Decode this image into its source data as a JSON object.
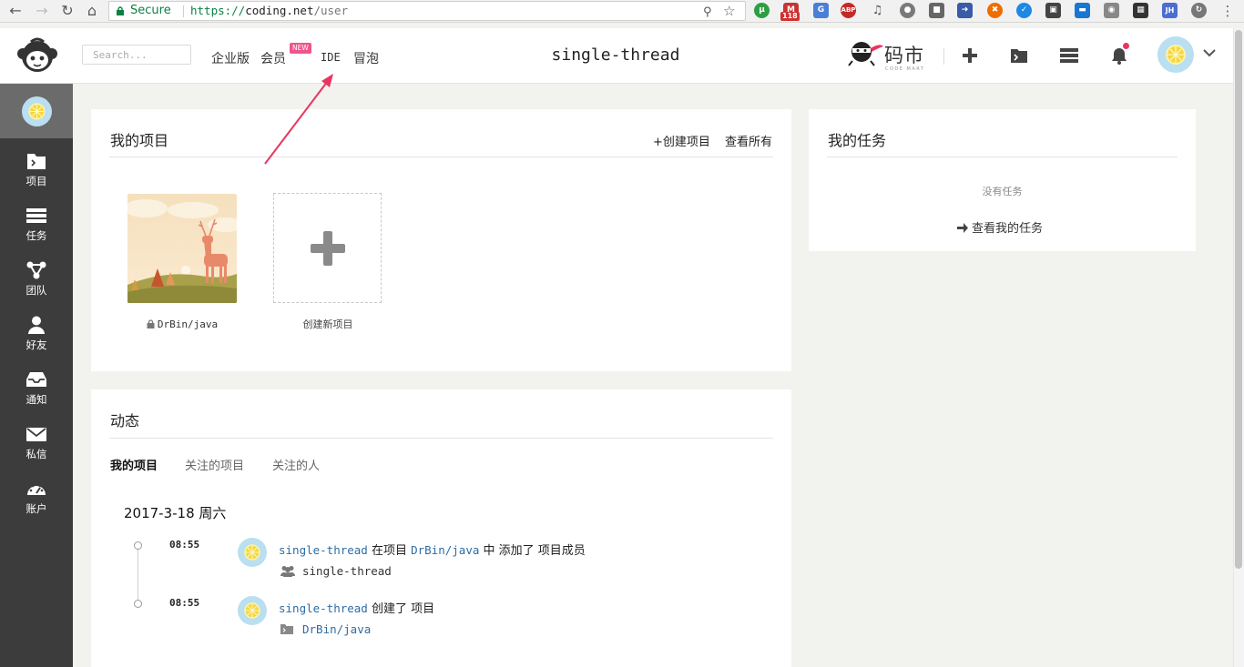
{
  "browser": {
    "secure_label": "Secure",
    "url_scheme": "https://",
    "url_host": "coding.net",
    "url_path": "/user",
    "extension_badge": "118",
    "ext_jh_label": "JH",
    "ext_abp_label": "ABP"
  },
  "header": {
    "search_placeholder": "Search...",
    "nav": {
      "enterprise": "企业版",
      "member": "会员",
      "member_badge": "NEW",
      "ide": "IDE",
      "bubble": "冒泡"
    },
    "username": "single-thread",
    "codemart_text": "码市",
    "codemart_sub": "CODE MART"
  },
  "sidebar": {
    "items": [
      {
        "label": "项目",
        "icon": "folder-icon"
      },
      {
        "label": "任务",
        "icon": "tasks-icon"
      },
      {
        "label": "团队",
        "icon": "team-icon"
      },
      {
        "label": "好友",
        "icon": "user-icon"
      },
      {
        "label": "通知",
        "icon": "inbox-icon"
      },
      {
        "label": "私信",
        "icon": "envelope-icon"
      },
      {
        "label": "账户",
        "icon": "dashboard-icon"
      }
    ]
  },
  "projects_panel": {
    "title": "我的项目",
    "create_link": "+创建项目",
    "view_all_link": "查看所有",
    "project_name": "DrBin/java",
    "create_new_label": "创建新项目"
  },
  "tasks_panel": {
    "title": "我的任务",
    "empty_text": "没有任务",
    "view_link": "查看我的任务"
  },
  "activity_panel": {
    "title": "动态",
    "tabs": [
      "我的项目",
      "关注的项目",
      "关注的人"
    ],
    "date": "2017-3-18 周六",
    "events": [
      {
        "time": "08:55",
        "actor": "single-thread",
        "text_1": " 在项目 ",
        "project": "DrBin/java",
        "text_2": " 中 添加了 项目成员",
        "detail": "single-thread",
        "detail_icon": "users-icon"
      },
      {
        "time": "08:55",
        "actor": "single-thread",
        "text_1": " 创建了 项目",
        "detail": "DrBin/java",
        "detail_icon": "folder-terminal-icon"
      }
    ]
  },
  "colors": {
    "sidebar_bg": "#3c3c3c",
    "page_bg": "#f2f2ee",
    "link": "#2e6ca4",
    "badge_pink": "#f0548c",
    "annotation_arrow": "#e8355f"
  }
}
